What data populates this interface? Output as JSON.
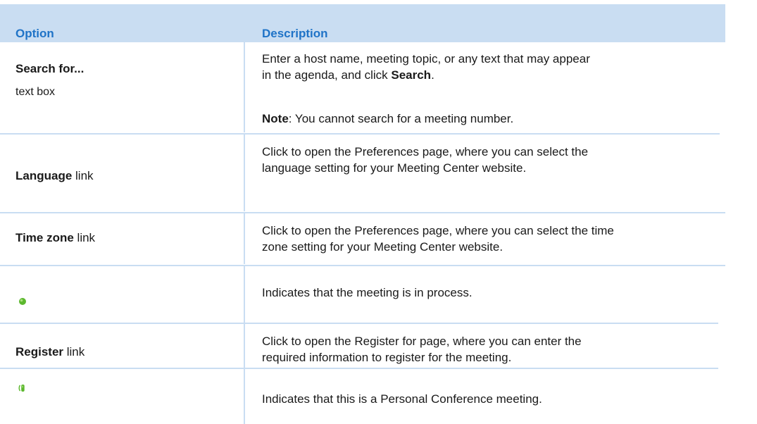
{
  "header": {
    "option": "Option",
    "description": "Description"
  },
  "rows": [
    {
      "option_bold": "Search for...",
      "option_sub": "text box",
      "desc_line1": "Enter a host name, meeting topic, or any text that may appear",
      "desc_line2_pre": "in the agenda, and click ",
      "desc_line2_bold": "Search",
      "desc_line2_post": ".",
      "note_bold": "Note",
      "note_text": ": You cannot search for a meeting number."
    },
    {
      "option_bold": "Language",
      "option_rest": " link",
      "desc_line1": "Click to open the Preferences page, where you can select the",
      "desc_line2": "language setting for your Meeting Center website."
    },
    {
      "option_bold": "Time zone",
      "option_rest": " link",
      "desc_line1": "Click to open the Preferences page, where you can select the time",
      "desc_line2": "zone setting for your Meeting Center website."
    },
    {
      "option_icon": "meeting-in-process-icon",
      "desc_line1": "Indicates that the meeting is in process."
    },
    {
      "option_bold": "Register",
      "option_rest": " link",
      "desc_line1": "Click to open the Register for page, where you can enter the",
      "desc_line2": "required information to register for the meeting."
    },
    {
      "option_icon": "personal-conference-icon",
      "desc_line1": "Indicates that this is a Personal Conference meeting."
    }
  ],
  "colors": {
    "header_bg": "#c9ddf2",
    "header_text": "#1f73c7",
    "body_text": "#1a1a1a",
    "icon_green": "#5cb82e"
  }
}
